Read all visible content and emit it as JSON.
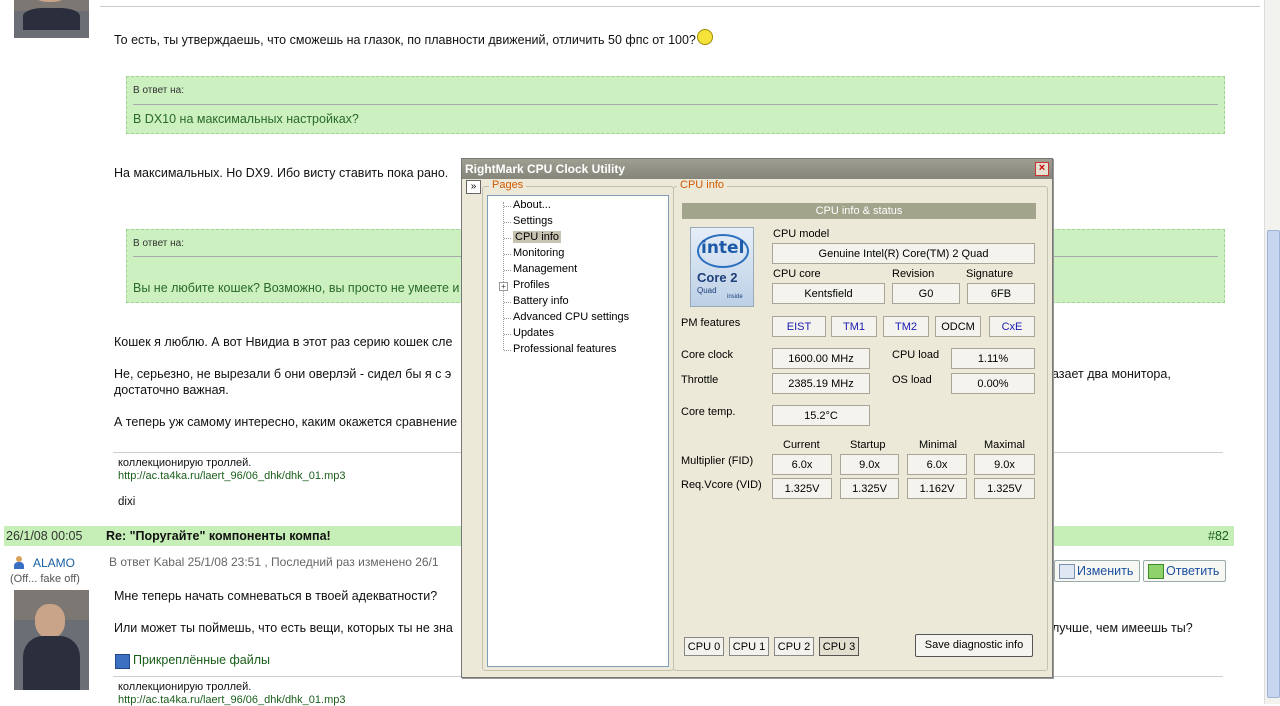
{
  "forum": {
    "reply_text_1": "То есть, ты утверждаешь, что сможешь на глазок, по плавности движений, отличить 50 фпс от 100?",
    "quote_header": "В ответ на:",
    "quote_1": "В DX10 на максимальных настройках?",
    "reply_text_2": "На максимальных. Но DX9. Ибо висту ставить пока рано.",
    "quote_2": "Вы не любите кошек? Возможно, вы просто не умеете и",
    "para_1": "Кошек я люблю. А вот Нвидиа в этот раз серию кошек сле",
    "para_2a": "Не, серьезно, не вырезали б они оверлэй - сидел бы я с э",
    "para_2b": "азает два монитора,",
    "para_2c": "достаточно важная.",
    "para_3": "А теперь уж самому интересно, каким окажется сравнение",
    "signature_text": "коллекционирую троллей.",
    "signature_link": "http://ac.ta4ka.ru/laert_96/06_dhk/dhk_01.mp3",
    "dixi": "dixi",
    "post_date": "26/1/08 00:05",
    "post_title": "Re: \"Поругайте\" компоненты компа!",
    "post_number": "#82",
    "user_name": "ALAMO",
    "user_status": "(Off... fake off)",
    "reply_meta": "В ответ Kabal 25/1/08 23:51 , Последний раз изменено 26/1",
    "edit_button": "Изменить",
    "reply_button": "Ответить",
    "post2_text_1": "Мне теперь начать сомневаться в твоей адекватности?",
    "post2_text_2a": "Или может ты поймешь, что есть вещи, которых ты не зна",
    "post2_text_2b": "лучше, чем имеешь ты?",
    "attached_files": "Прикреплённые файлы",
    "signature2_text": "коллекционирую троллей.",
    "signature2_link": "http://ac.ta4ka.ru/laert_96/06_dhk/dhk_01.mp3"
  },
  "window": {
    "title": "RightMark CPU Clock Utility",
    "close": "×",
    "collapse": "»",
    "pages_label": "Pages",
    "cpuinfo_label": "CPU info",
    "pages": [
      "About...",
      "Settings",
      "CPU info",
      "Monitoring",
      "Management",
      "Profiles",
      "Battery info",
      "Advanced CPU settings",
      "Updates",
      "Professional features"
    ],
    "header_bar": "CPU info & status",
    "logo": {
      "brand": "intel",
      "line2": "Core 2",
      "line3": "Quad",
      "line4": "inside"
    },
    "cpu_model_label": "CPU model",
    "cpu_model": "Genuine Intel(R) Core(TM) 2 Quad",
    "cpu_core_label": "CPU core",
    "cpu_core": "Kentsfield",
    "revision_label": "Revision",
    "revision": "G0",
    "signature_label": "Signature",
    "signature": "6FB",
    "pm_features_label": "PM features",
    "pm_features": [
      "EIST",
      "TM1",
      "TM2",
      "ODCM",
      "CxE"
    ],
    "core_clock_label": "Core clock",
    "core_clock": "1600.00 MHz",
    "cpu_load_label": "CPU load",
    "cpu_load": "1.11%",
    "throttle_label": "Throttle",
    "throttle": "2385.19 MHz",
    "os_load_label": "OS load",
    "os_load": "0.00%",
    "core_temp_label": "Core temp.",
    "core_temp": "15.2°C",
    "col_current": "Current",
    "col_startup": "Startup",
    "col_minimal": "Minimal",
    "col_maximal": "Maximal",
    "multiplier_label": "Multiplier (FID)",
    "multiplier": [
      "6.0x",
      "9.0x",
      "6.0x",
      "9.0x"
    ],
    "vcore_label": "Req.Vcore (VID)",
    "vcore": [
      "1.325V",
      "1.325V",
      "1.162V",
      "1.325V"
    ],
    "cpu_tabs": [
      "CPU 0",
      "CPU 1",
      "CPU 2",
      "CPU 3"
    ],
    "save_button": "Save diagnostic info"
  }
}
